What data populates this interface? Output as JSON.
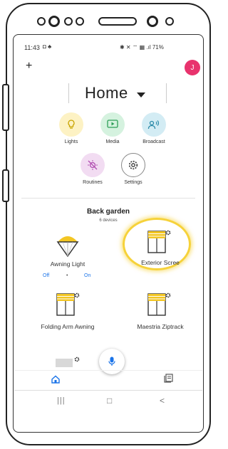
{
  "status_bar": {
    "time": "11:43",
    "right": "✱ ✕ ⌔ ▦ .ıl 71%"
  },
  "header": {
    "add_label": "+",
    "avatar_letter": "J",
    "avatar_color": "#e8336d",
    "title": "Home",
    "dropdown_icon": "caret-down-icon"
  },
  "shortcuts": [
    {
      "label": "Lights",
      "icon": "bulb-icon",
      "bg": "#fdf2c4"
    },
    {
      "label": "Media",
      "icon": "media-icon",
      "bg": "#d5f2df"
    },
    {
      "label": "Broadcast",
      "icon": "broadcast-icon",
      "bg": "#d3ecf4"
    },
    {
      "label": "Routines",
      "icon": "routines-icon",
      "bg": "#f2dcf2"
    },
    {
      "label": "Settings",
      "icon": "gear-icon",
      "bg": "#ffffff"
    }
  ],
  "section": {
    "title": "Back garden",
    "subtitle": "6 devices"
  },
  "devices": [
    {
      "label": "Awning Light",
      "icon": "lamp-icon",
      "controls": {
        "off": "Off",
        "dot": "•",
        "on": "On"
      }
    },
    {
      "label": "Exterior Scree",
      "icon": "blind-icon",
      "highlighted": true
    },
    {
      "label": "Folding Arm Awning",
      "icon": "blind-icon"
    },
    {
      "label": "Maestria Ziptrack",
      "icon": "blind-icon"
    },
    {
      "label": "",
      "icon": "blind-icon"
    }
  ],
  "fab": {
    "icon": "microphone-icon"
  },
  "bottom_nav": {
    "home_icon": "home-icon",
    "feed_icon": "feed-icon"
  },
  "system_nav": {
    "recent": "|||",
    "home": "□",
    "back": "<"
  },
  "colors": {
    "accent_blue": "#1a73e8",
    "highlight_ring": "#f6d23a",
    "blind_yellow": "#f3c623"
  }
}
